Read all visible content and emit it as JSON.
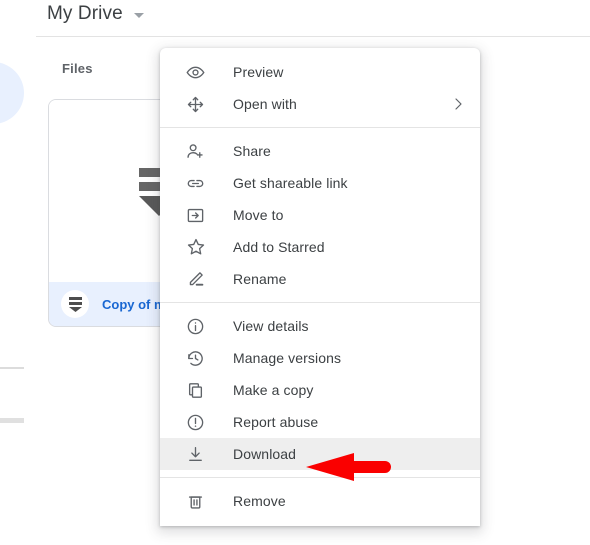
{
  "app": {
    "header": {
      "breadcrumb_title": "My Drive",
      "caret_icon": "chevron-down-icon"
    },
    "section_label": "Files"
  },
  "file_card": {
    "name": "Copy of m",
    "badge_icon": "forms-file-icon",
    "thumbnail_icon": "forms-logo",
    "selected": true,
    "accent_color": "#1967d2",
    "selected_bg": "#e8f0fe"
  },
  "context_menu": {
    "highlighted_item": "Download",
    "highlight_color": "#eeeeee",
    "groups": [
      {
        "items": [
          {
            "label": "Preview",
            "icon": "eye-icon",
            "submenu": false
          },
          {
            "label": "Open with",
            "icon": "open-with-move-icon",
            "submenu": true,
            "submenu_icon": "chevron-right-icon"
          }
        ]
      },
      {
        "items": [
          {
            "label": "Share",
            "icon": "person-add-icon",
            "submenu": false
          },
          {
            "label": "Get shareable link",
            "icon": "link-icon",
            "submenu": false
          },
          {
            "label": "Move to",
            "icon": "move-to-folder-icon",
            "submenu": false
          },
          {
            "label": "Add to Starred",
            "icon": "star-outline-icon",
            "submenu": false
          },
          {
            "label": "Rename",
            "icon": "pencil-icon",
            "submenu": false
          }
        ]
      },
      {
        "items": [
          {
            "label": "View details",
            "icon": "info-circle-icon",
            "submenu": false
          },
          {
            "label": "Manage versions",
            "icon": "history-restore-icon",
            "submenu": false
          },
          {
            "label": "Make a copy",
            "icon": "copy-icon",
            "submenu": false
          },
          {
            "label": "Report abuse",
            "icon": "exclamation-circle-icon",
            "submenu": false
          },
          {
            "label": "Download",
            "icon": "download-icon",
            "submenu": false
          }
        ]
      },
      {
        "items": [
          {
            "label": "Remove",
            "icon": "trash-icon",
            "submenu": false
          }
        ]
      }
    ]
  },
  "annotation": {
    "arrow_color": "#fa0000",
    "points_to": "Download"
  }
}
